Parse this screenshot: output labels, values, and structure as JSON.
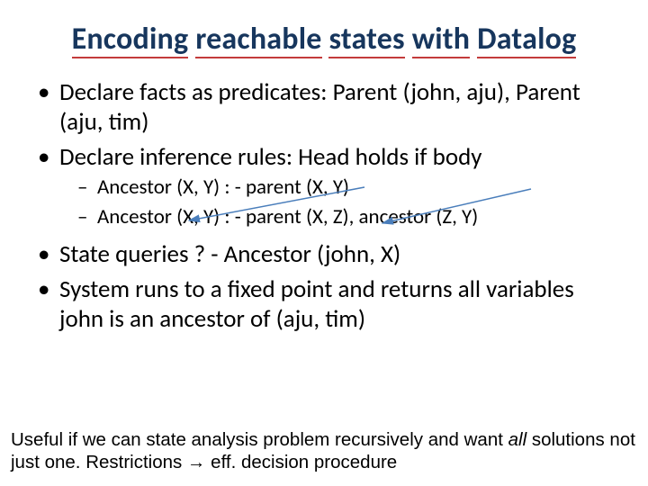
{
  "title_words": [
    "Encoding",
    "reachable",
    "states",
    "with",
    "Datalog"
  ],
  "bullets": {
    "b1": "Declare facts as predicates: Parent (john, aju), Parent (aju, tim)",
    "b2": "Declare inference rules: Head holds if body",
    "sub1": "Ancestor (X, Y) : - parent (X, Y)",
    "sub2": "Ancestor (X, Y) : - parent (X, Z), ancestor (Z, Y)",
    "b3": "State queries  ? - Ancestor (john, X)",
    "b4": "System runs to a fixed point and returns all variables john is an ancestor of (aju, tim)"
  },
  "footnote": {
    "part1": "Useful if we can state analysis problem recursively and want ",
    "all": "all",
    "part2": " solutions not just one. Restrictions ",
    "arrow": "→",
    "part3": " eff. decision procedure"
  }
}
